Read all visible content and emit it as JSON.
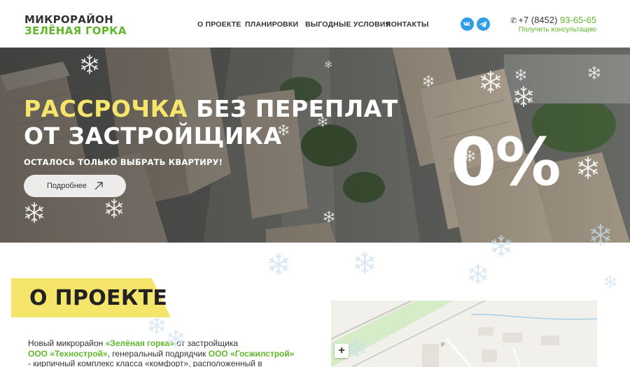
{
  "header": {
    "logo_top": "МИКРОРАЙОН",
    "logo_bottom": "ЗЕЛЁНАЯ ГОРКА",
    "nav": [
      "О ПРОЕКТЕ",
      "ПЛАНИРОВКИ",
      "ВЫГОДНЫЕ УСЛОВИЯ",
      "КОНТАКТЫ"
    ],
    "phone_prefix": "+7 (8452)",
    "phone_number": "93-65-65",
    "consult": "Получить консультацию",
    "social_icons": [
      "vk-icon",
      "telegram-icon"
    ]
  },
  "hero": {
    "title_accent": "РАССРОЧКА",
    "title_line1_rest": " БЕЗ ПЕРЕПЛАТ",
    "title_line2": "ОТ ЗАСТРОЙЩИКА",
    "subtitle": "ОСТАЛОСЬ ТОЛЬКО ВЫБРАТЬ КВАРТИРУ!",
    "button_label": "Подробнее",
    "big_value": "0%"
  },
  "about": {
    "title": "О ПРОЕКТЕ",
    "t1": "Новый микрорайон ",
    "t2": "«Зелёная горка»",
    "t3": " от застройщика",
    "t4": "ООО «Технострой»",
    "t5": ", генеральный подрядчик ",
    "t6": "ООО «Госжилстрой»",
    "t7": "- кирпичный комплекс класса «комфорт», расположенный в"
  },
  "map": {
    "zoom_in": "+",
    "label": "Р"
  },
  "colors": {
    "brand_green": "#5fb82a",
    "accent_yellow": "#f5e56a",
    "social_blue": "#2f9ee8"
  }
}
